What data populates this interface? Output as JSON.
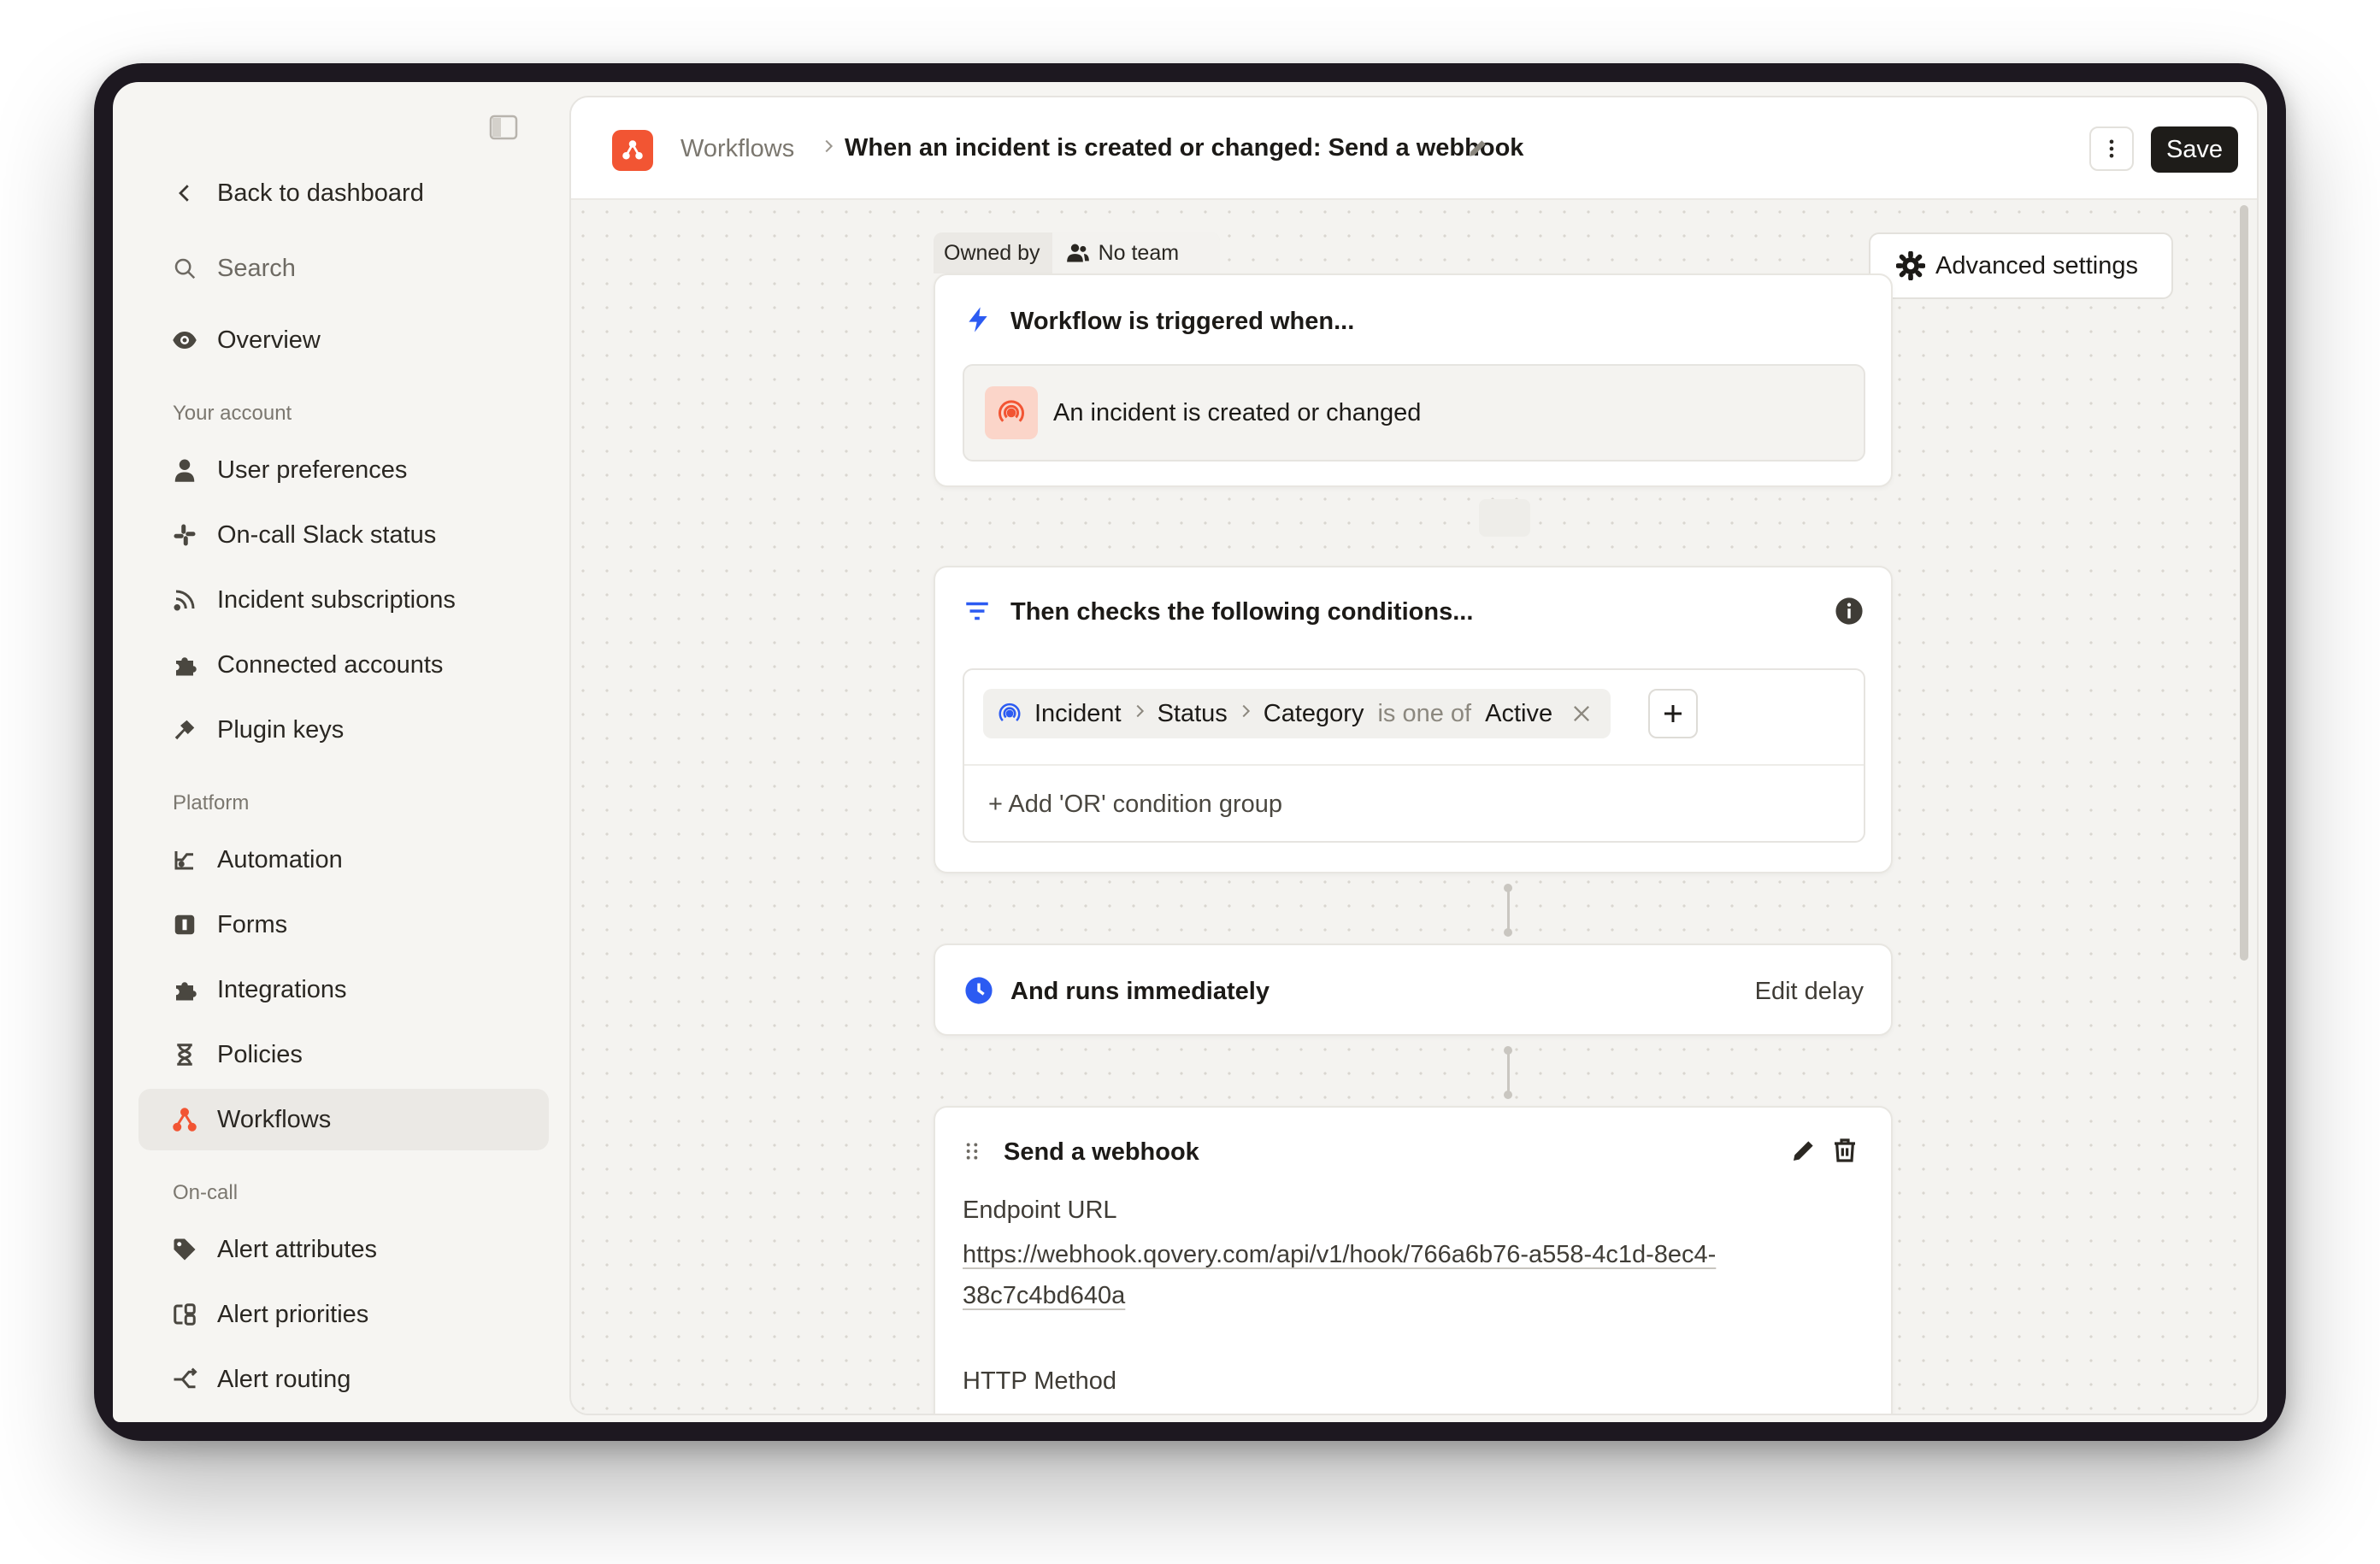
{
  "sidebar": {
    "back_label": "Back to dashboard",
    "search_label": "Search",
    "overview_label": "Overview",
    "sections": {
      "your_account": "Your account",
      "platform": "Platform",
      "on_call": "On-call"
    },
    "account_items": [
      "User preferences",
      "On-call Slack status",
      "Incident subscriptions",
      "Connected accounts",
      "Plugin keys"
    ],
    "platform_items": [
      "Automation",
      "Forms",
      "Integrations",
      "Policies",
      "Workflows"
    ],
    "oncall_items": [
      "Alert attributes",
      "Alert priorities",
      "Alert routing"
    ],
    "active_item": "Workflows",
    "accent_color": "#f25533"
  },
  "header": {
    "breadcrumb_root": "Workflows",
    "title": "When an incident is created or changed: Send a webhook",
    "save_label": "Save"
  },
  "owner": {
    "label": "Owned by",
    "team": "No team"
  },
  "advanced_settings_label": "Advanced settings",
  "trigger": {
    "title": "Workflow is triggered when...",
    "event": "An incident is created or changed"
  },
  "conditions": {
    "title": "Then checks the following conditions...",
    "chip": {
      "entity": "Incident",
      "field1": "Status",
      "field2": "Category",
      "operator": "is one of",
      "value": "Active"
    },
    "add_or_label": "+ Add 'OR' condition group"
  },
  "delay": {
    "title": "And runs immediately",
    "edit_label": "Edit delay"
  },
  "step": {
    "title": "Send a webhook",
    "endpoint_label": "Endpoint URL",
    "endpoint_url_line1": "https://webhook.qovery.com/api/v1/hook/766a6b76-a558-4c1d-8ec4-",
    "endpoint_url_line2": "38c7c4bd640a",
    "method_label": "HTTP Method"
  }
}
